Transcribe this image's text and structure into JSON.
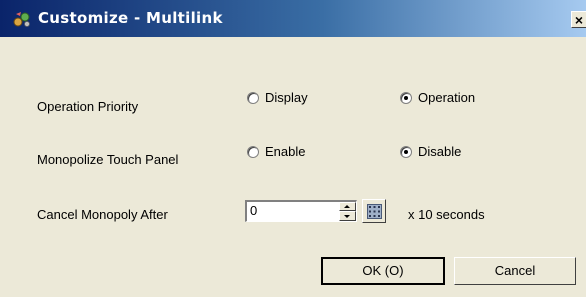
{
  "window": {
    "title": "Customize - Multilink",
    "close_glyph": "×",
    "title_icon": "multilink-app-icon"
  },
  "rows": {
    "operation_priority": {
      "label": "Operation Priority",
      "options": [
        {
          "label": "Display",
          "checked": false
        },
        {
          "label": "Operation",
          "checked": true
        }
      ]
    },
    "monopolize_touch_panel": {
      "label": "Monopolize Touch Panel",
      "options": [
        {
          "label": "Enable",
          "checked": false
        },
        {
          "label": "Disable",
          "checked": true
        }
      ]
    },
    "cancel_monopoly": {
      "label": "Cancel Monopoly After",
      "value": "0",
      "unit": "x 10 seconds",
      "keypad_icon": "keypad-icon"
    }
  },
  "buttons": {
    "ok": "OK (O)",
    "cancel": "Cancel"
  }
}
